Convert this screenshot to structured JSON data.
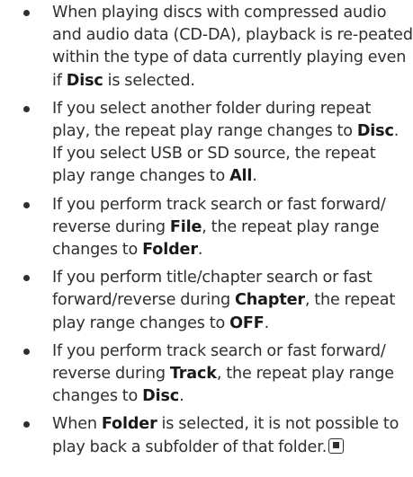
{
  "bullets": [
    {
      "parts": [
        "When playing discs with compressed audio and audio data (CD-DA), playback is re-peated within the type of data currently playing even if ",
        {
          "b": "Disc"
        },
        " is selected."
      ]
    },
    {
      "parts": [
        "If you select another folder during repeat play, the repeat play range changes to ",
        {
          "b": "Disc"
        },
        ". If you select USB or SD source, the repeat play range changes to ",
        {
          "b": "All"
        },
        "."
      ]
    },
    {
      "parts": [
        "If you perform track search or fast forward/ reverse during ",
        {
          "b": "File"
        },
        ", the repeat play range changes to ",
        {
          "b": "Folder"
        },
        "."
      ]
    },
    {
      "parts": [
        "If you perform title/chapter search or fast forward/reverse during ",
        {
          "b": "Chapter"
        },
        ", the repeat play range changes to ",
        {
          "b": "OFF"
        },
        "."
      ]
    },
    {
      "parts": [
        "If you perform track search or fast forward/ reverse during ",
        {
          "b": "Track"
        },
        ", the repeat play range changes to ",
        {
          "b": "Disc"
        },
        "."
      ]
    },
    {
      "parts": [
        "When ",
        {
          "b": "Folder"
        },
        " is selected, it is not possible to play back a subfolder of that folder."
      ],
      "end_mark": "end-of-section-icon"
    }
  ]
}
